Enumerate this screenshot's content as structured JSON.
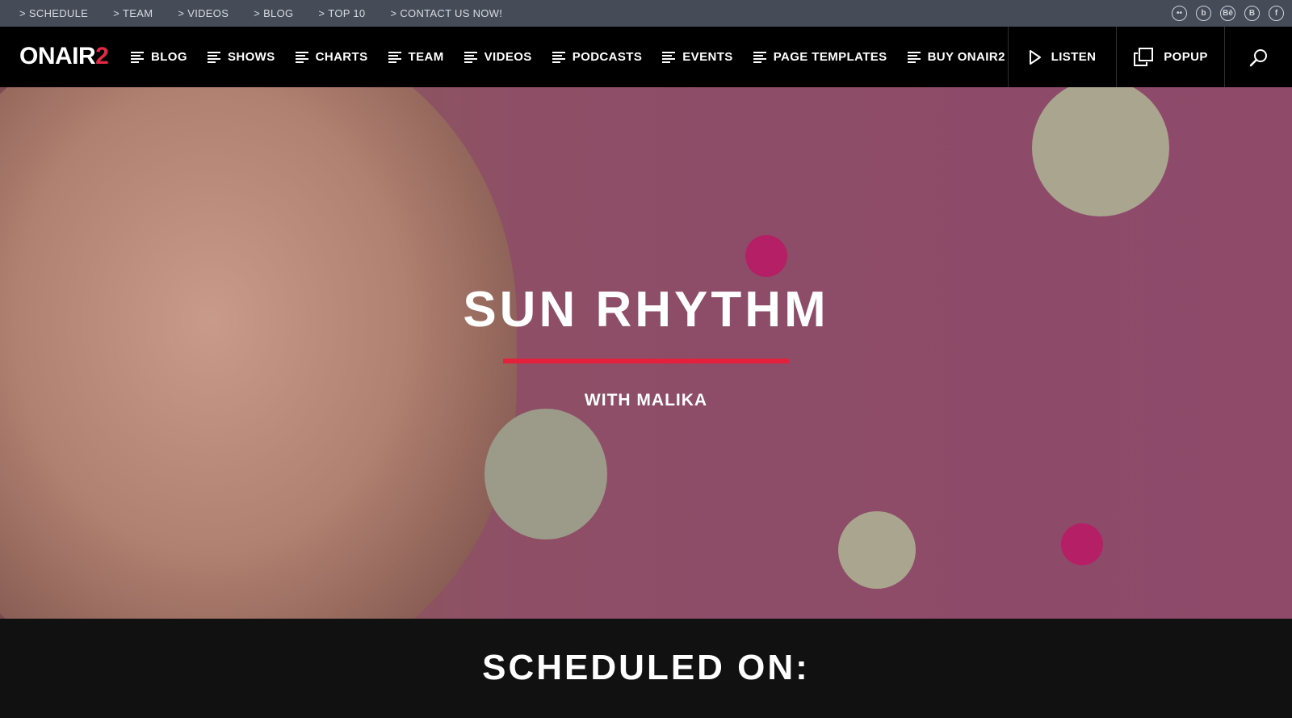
{
  "topbar": {
    "links": [
      {
        "label": "SCHEDULE"
      },
      {
        "label": "TEAM"
      },
      {
        "label": "VIDEOS"
      },
      {
        "label": "BLOG"
      },
      {
        "label": "TOP 10"
      },
      {
        "label": "CONTACT US NOW!"
      }
    ],
    "social": [
      {
        "icon": "flickr-icon",
        "glyph": "••"
      },
      {
        "icon": "blogger-icon",
        "glyph": "b"
      },
      {
        "icon": "behance-icon",
        "glyph": "Bē"
      },
      {
        "icon": "blogger-alt-icon",
        "glyph": "B"
      },
      {
        "icon": "facebook-icon",
        "glyph": "f"
      }
    ]
  },
  "nav": {
    "logo_main": "ONAIR",
    "logo_accent": "2",
    "items": [
      {
        "label": "BLOG"
      },
      {
        "label": "SHOWS"
      },
      {
        "label": "CHARTS"
      },
      {
        "label": "TEAM"
      },
      {
        "label": "VIDEOS"
      },
      {
        "label": "PODCASTS"
      },
      {
        "label": "EVENTS"
      },
      {
        "label": "PAGE TEMPLATES"
      },
      {
        "label": "BUY ONAIR2"
      }
    ],
    "listen_label": "LISTEN",
    "popup_label": "POPUP"
  },
  "hero": {
    "title": "SUN RHYTHM",
    "subtitle": "WITH MALIKA"
  },
  "schedule": {
    "heading": "SCHEDULED ON:"
  },
  "colors": {
    "accent": "#e3213d",
    "topbar_bg": "#454b57",
    "nav_bg": "#000000"
  }
}
